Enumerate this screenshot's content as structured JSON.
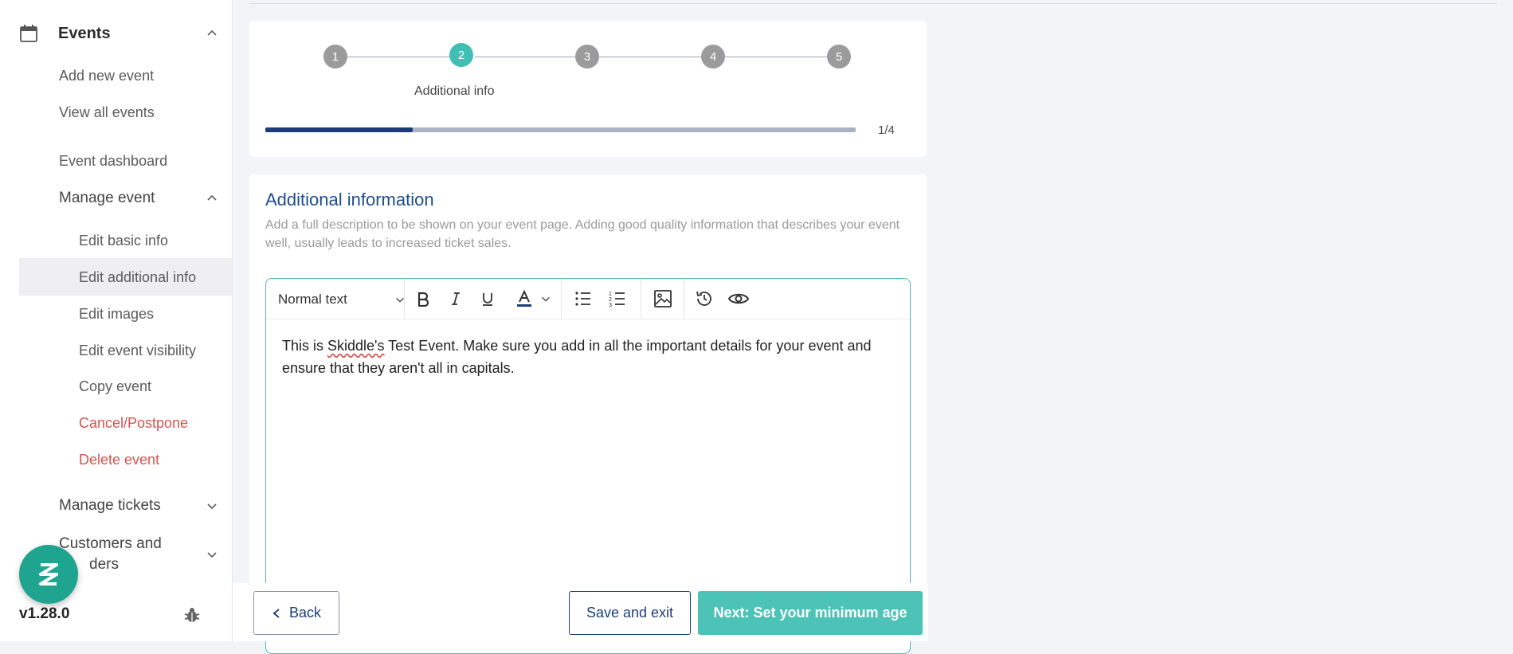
{
  "sidebar": {
    "events_label": "Events",
    "add_new_event": "Add new event",
    "view_all_events": "View all events",
    "event_dashboard": "Event dashboard",
    "manage_event": "Manage event",
    "sub_items": {
      "edit_basic_info": "Edit basic info",
      "edit_additional_info": "Edit additional info",
      "edit_images": "Edit images",
      "edit_event_visibility": "Edit event visibility",
      "copy_event": "Copy event",
      "cancel_postpone": "Cancel/Postpone",
      "delete_event": "Delete event"
    },
    "manage_tickets": "Manage tickets",
    "customers_line1": "Customers and",
    "customers_line2": "ders",
    "version": "v1.28.0"
  },
  "stepper": {
    "steps": [
      "1",
      "2",
      "3",
      "4",
      "5"
    ],
    "active_step": 2,
    "active_label": "Additional info",
    "progress_fraction": 0.25,
    "progress_text": "1/4"
  },
  "section": {
    "title": "Additional information",
    "description": "Add a full description to be shown on your event page. Adding good quality information that describes your event well, usually leads to increased ticket sales."
  },
  "editor": {
    "format_select": "Normal text",
    "text_before": "This is ",
    "text_misspelled": "Skiddle's",
    "text_after": " Test Event. Make sure you add in all the important details for your event and ensure that they aren't all in capitals."
  },
  "footer": {
    "back_label": "Back",
    "save_label": "Save and exit",
    "next_label": "Next: Set your minimum age"
  },
  "colors": {
    "accent": "#4cc3b6",
    "primary": "#1d3f7a",
    "danger": "#d9534f"
  }
}
